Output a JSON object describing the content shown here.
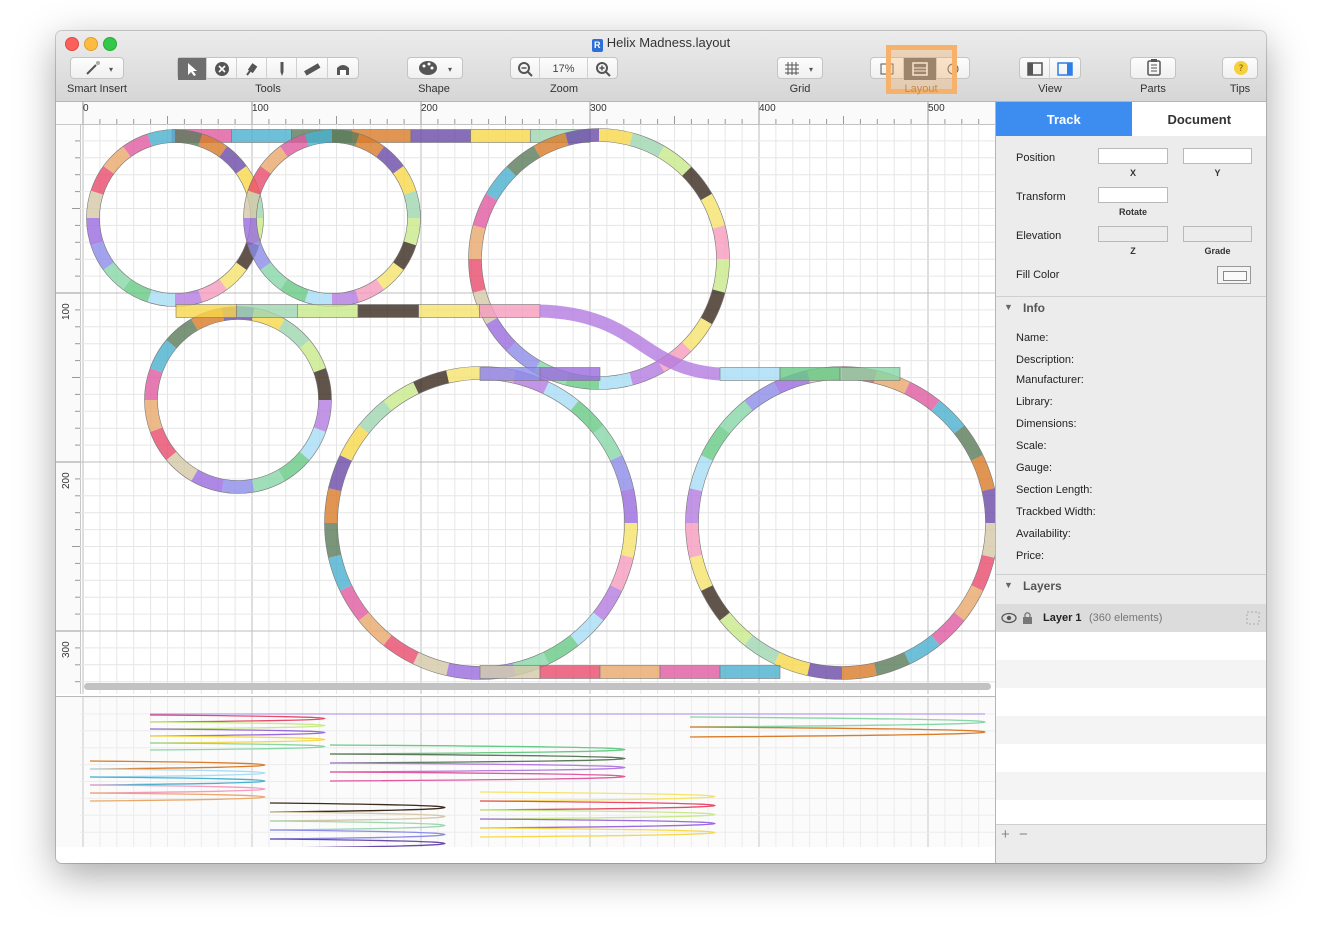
{
  "window": {
    "title": "Helix Madness.layout"
  },
  "toolbar": {
    "smart_insert": "Smart Insert",
    "tools": "Tools",
    "shape": "Shape",
    "zoom": "Zoom",
    "zoom_value": "17%",
    "grid": "Grid",
    "layout": "Layout",
    "view": "View",
    "parts": "Parts",
    "tips": "Tips",
    "tips_glyph": "?"
  },
  "ruler": {
    "top": [
      "0",
      "100",
      "200",
      "300",
      "400",
      "500"
    ],
    "left": [
      "100",
      "200",
      "300"
    ]
  },
  "sidebar": {
    "tabs": [
      "Track",
      "Document"
    ],
    "properties": {
      "position": "Position",
      "x": "X",
      "y": "Y",
      "transform": "Transform",
      "rotate": "Rotate",
      "elevation": "Elevation",
      "z": "Z",
      "grade": "Grade",
      "fill_color": "Fill Color"
    },
    "info": {
      "header": "Info",
      "fields": [
        "Name:",
        "Description:",
        "Manufacturer:",
        "Library:",
        "Dimensions:",
        "Scale:",
        "Gauge:",
        "Section Length:",
        "Trackbed Width:",
        "Availability:",
        "Price:"
      ]
    },
    "layers": {
      "header": "Layers",
      "items": [
        {
          "name": "Layer 1",
          "count": "(360 elements)"
        }
      ]
    },
    "add": "+",
    "remove": "−"
  },
  "colors": {
    "accent": "#3d8cf0",
    "highlight": "#f6b26b",
    "track_palette": [
      "#e05aa0",
      "#d97b28",
      "#9fd6b0",
      "#f5e36b",
      "#a7dcf4",
      "#8c8ce8",
      "#e84a6a",
      "#4ab0d0",
      "#6a4aa8",
      "#c8e88a",
      "#f59bbd",
      "#67c985",
      "#9a6adf",
      "#e8a86b",
      "#5a7a5a",
      "#f7d84a",
      "#3a2a1e",
      "#b47ae0",
      "#86d6a6",
      "#d4c8a8"
    ]
  }
}
